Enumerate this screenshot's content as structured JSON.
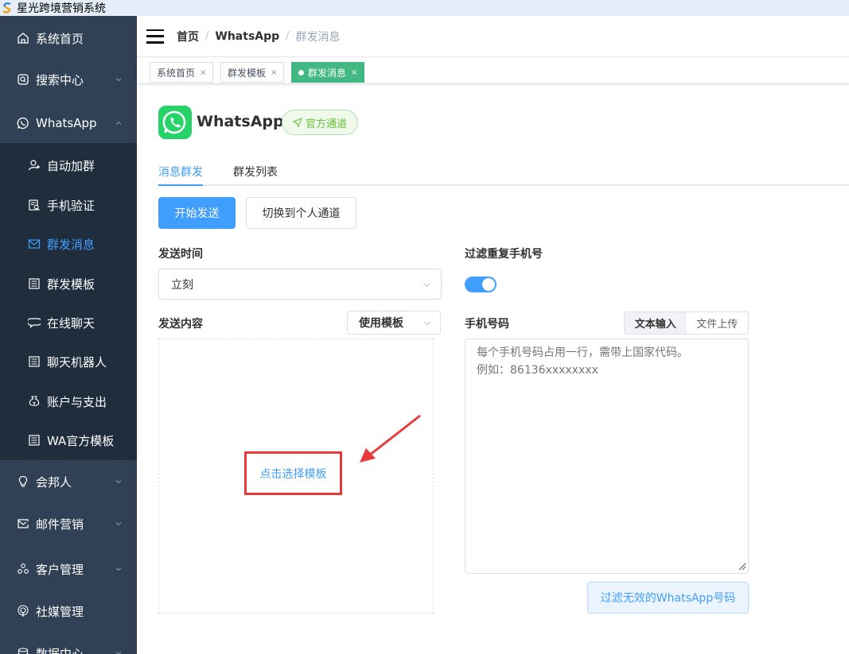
{
  "app": {
    "title": "星光跨境营销系统"
  },
  "sidebar": {
    "items": [
      {
        "label": "系统首页",
        "icon": "home-icon"
      },
      {
        "label": "搜索中心",
        "icon": "search-icon",
        "expandable": true
      },
      {
        "label": "WhatsApp",
        "icon": "whatsapp-icon",
        "expandable": true,
        "expanded": true
      },
      {
        "label": "会邦人",
        "icon": "bulb-icon",
        "expandable": true
      },
      {
        "label": "邮件营销",
        "icon": "mail-icon",
        "expandable": true
      },
      {
        "label": "客户管理",
        "icon": "users-icon",
        "expandable": true
      },
      {
        "label": "社媒管理",
        "icon": "broadcast-icon"
      },
      {
        "label": "数据中心",
        "icon": "database-icon",
        "expandable": true
      }
    ],
    "whatsapp_children": [
      {
        "label": "自动加群",
        "icon": "user-add-icon"
      },
      {
        "label": "手机验证",
        "icon": "verify-icon"
      },
      {
        "label": "群发消息",
        "icon": "message-icon",
        "active": true
      },
      {
        "label": "群发模板",
        "icon": "template-icon"
      },
      {
        "label": "在线聊天",
        "icon": "chat-icon"
      },
      {
        "label": "聊天机器人",
        "icon": "robot-icon"
      },
      {
        "label": "账户与支出",
        "icon": "wallet-icon"
      },
      {
        "label": "WA官方模板",
        "icon": "template-icon"
      }
    ]
  },
  "navbar": {
    "breadcrumb": [
      "首页",
      "WhatsApp",
      "群发消息"
    ]
  },
  "tags": [
    {
      "label": "系统首页",
      "close": "×"
    },
    {
      "label": "群发模板",
      "close": "×"
    },
    {
      "label": "群发消息",
      "close": "×",
      "active": true
    }
  ],
  "channel": {
    "name": "WhatsApp",
    "badge": "官方通道"
  },
  "tabs": [
    {
      "label": "消息群发",
      "active": true
    },
    {
      "label": "群发列表"
    }
  ],
  "actions": {
    "start_send": "开始发送",
    "switch_personal": "切换到个人通道"
  },
  "form": {
    "send_time_label": "发送时间",
    "send_time_value": "立刻",
    "filter_dup_label": "过滤重复手机号",
    "filter_dup_on": true,
    "content_label": "发送内容",
    "use_template": "使用模板",
    "choose_template": "点击选择模板",
    "phone_label": "手机号码",
    "input_modes": [
      "文本输入",
      "文件上传"
    ],
    "phone_placeholder": "每个手机号码占用一行，需带上国家代码。\n例如：86136xxxxxxxx",
    "filter_invalid_button": "过滤无效的WhatsApp号码"
  },
  "colors": {
    "sidebar_bg": "#304156",
    "submenu_bg": "#1f2d3d",
    "primary": "#409eff",
    "tag_active": "#42b983",
    "whatsapp_green": "#25d366",
    "annotation_red": "#e83a3a"
  }
}
